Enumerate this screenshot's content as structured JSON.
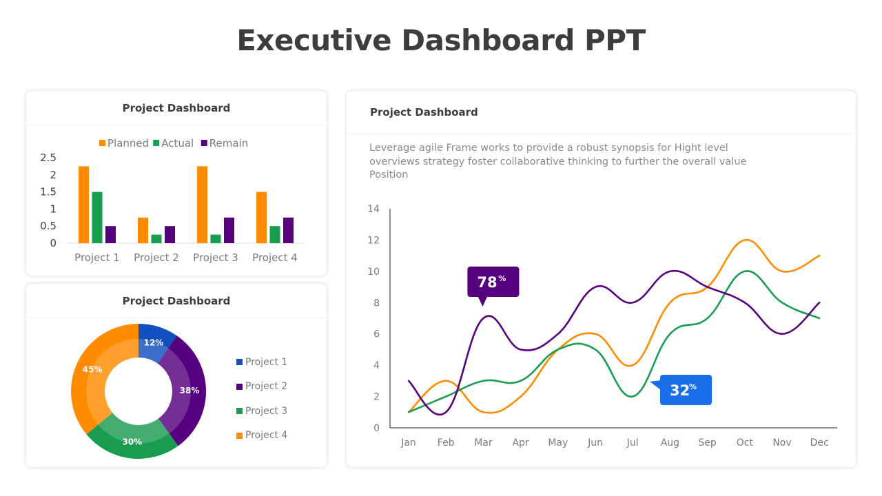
{
  "title": "Executive Dashboard PPT",
  "colors": {
    "orange": "#ff8c00",
    "green": "#1a9c50",
    "purple": "#57007f",
    "blue": "#1150be",
    "callout_purple": "#57007f",
    "callout_blue": "#1a6fe8"
  },
  "bar_card": {
    "title": "Project Dashboard"
  },
  "donut_card": {
    "title": "Project Dashboard"
  },
  "line_card": {
    "title": "Project Dashboard",
    "description": "Leverage agile Frame works to provide a robust synopsis for Hight level overviews strategy foster collaborative thinking to further the overall value Position"
  },
  "chart_data": [
    {
      "type": "bar",
      "title": "Project Dashboard",
      "categories": [
        "Project 1",
        "Project 2",
        "Project 3",
        "Project 4"
      ],
      "series": [
        {
          "name": "Planned",
          "color": "#ff8c00",
          "values": [
            2.25,
            0.75,
            2.25,
            1.5
          ]
        },
        {
          "name": "Actual",
          "color": "#1a9c50",
          "values": [
            1.5,
            0.25,
            0.25,
            0.5
          ]
        },
        {
          "name": "Remain",
          "color": "#57007f",
          "values": [
            0.5,
            0.5,
            0.75,
            0.75
          ]
        }
      ],
      "yticks": [
        "0",
        "0.5",
        "1",
        "1.5",
        "2",
        "2.5"
      ],
      "ylim": [
        0,
        2.5
      ],
      "xlabel": "",
      "ylabel": "",
      "legend": "top"
    },
    {
      "type": "pie",
      "variant": "donut",
      "title": "Project Dashboard",
      "labels": [
        "Project 1",
        "Project 2",
        "Project 3",
        "Project 4"
      ],
      "values": [
        12,
        38,
        30,
        45
      ],
      "value_labels": [
        "12%",
        "38%",
        "30%",
        "45%"
      ],
      "colors": [
        "#1150be",
        "#57007f",
        "#1a9c50",
        "#ff8c00"
      ],
      "legend": "right"
    },
    {
      "type": "line",
      "title": "Project Dashboard",
      "x": [
        "Jan",
        "Feb",
        "Mar",
        "Apr",
        "May",
        "Jun",
        "Jul",
        "Aug",
        "Sep",
        "Oct",
        "Nov",
        "Dec"
      ],
      "series": [
        {
          "name": "Orange",
          "color": "#ff8c00",
          "values": [
            1,
            3,
            1,
            2,
            5,
            6,
            4,
            8,
            9,
            12,
            10,
            11
          ]
        },
        {
          "name": "Green",
          "color": "#1a9c50",
          "values": [
            1,
            2,
            3,
            3,
            5,
            5,
            2,
            6,
            7,
            10,
            8,
            7
          ]
        },
        {
          "name": "Purple",
          "color": "#57007f",
          "values": [
            3,
            1,
            7,
            5,
            6,
            9,
            8,
            10,
            9,
            8,
            6,
            8
          ]
        }
      ],
      "yticks": [
        "0",
        "2",
        "4",
        "6",
        "8",
        "10",
        "12",
        "14"
      ],
      "ylim": [
        0,
        14
      ],
      "annotations": [
        {
          "text": "78",
          "suffix": "%",
          "series": "Purple",
          "x": "Mar",
          "color": "#57007f"
        },
        {
          "text": "32",
          "suffix": "%",
          "series": "Green",
          "x": "Jul",
          "color": "#1a6fe8"
        }
      ],
      "grid": false
    }
  ]
}
